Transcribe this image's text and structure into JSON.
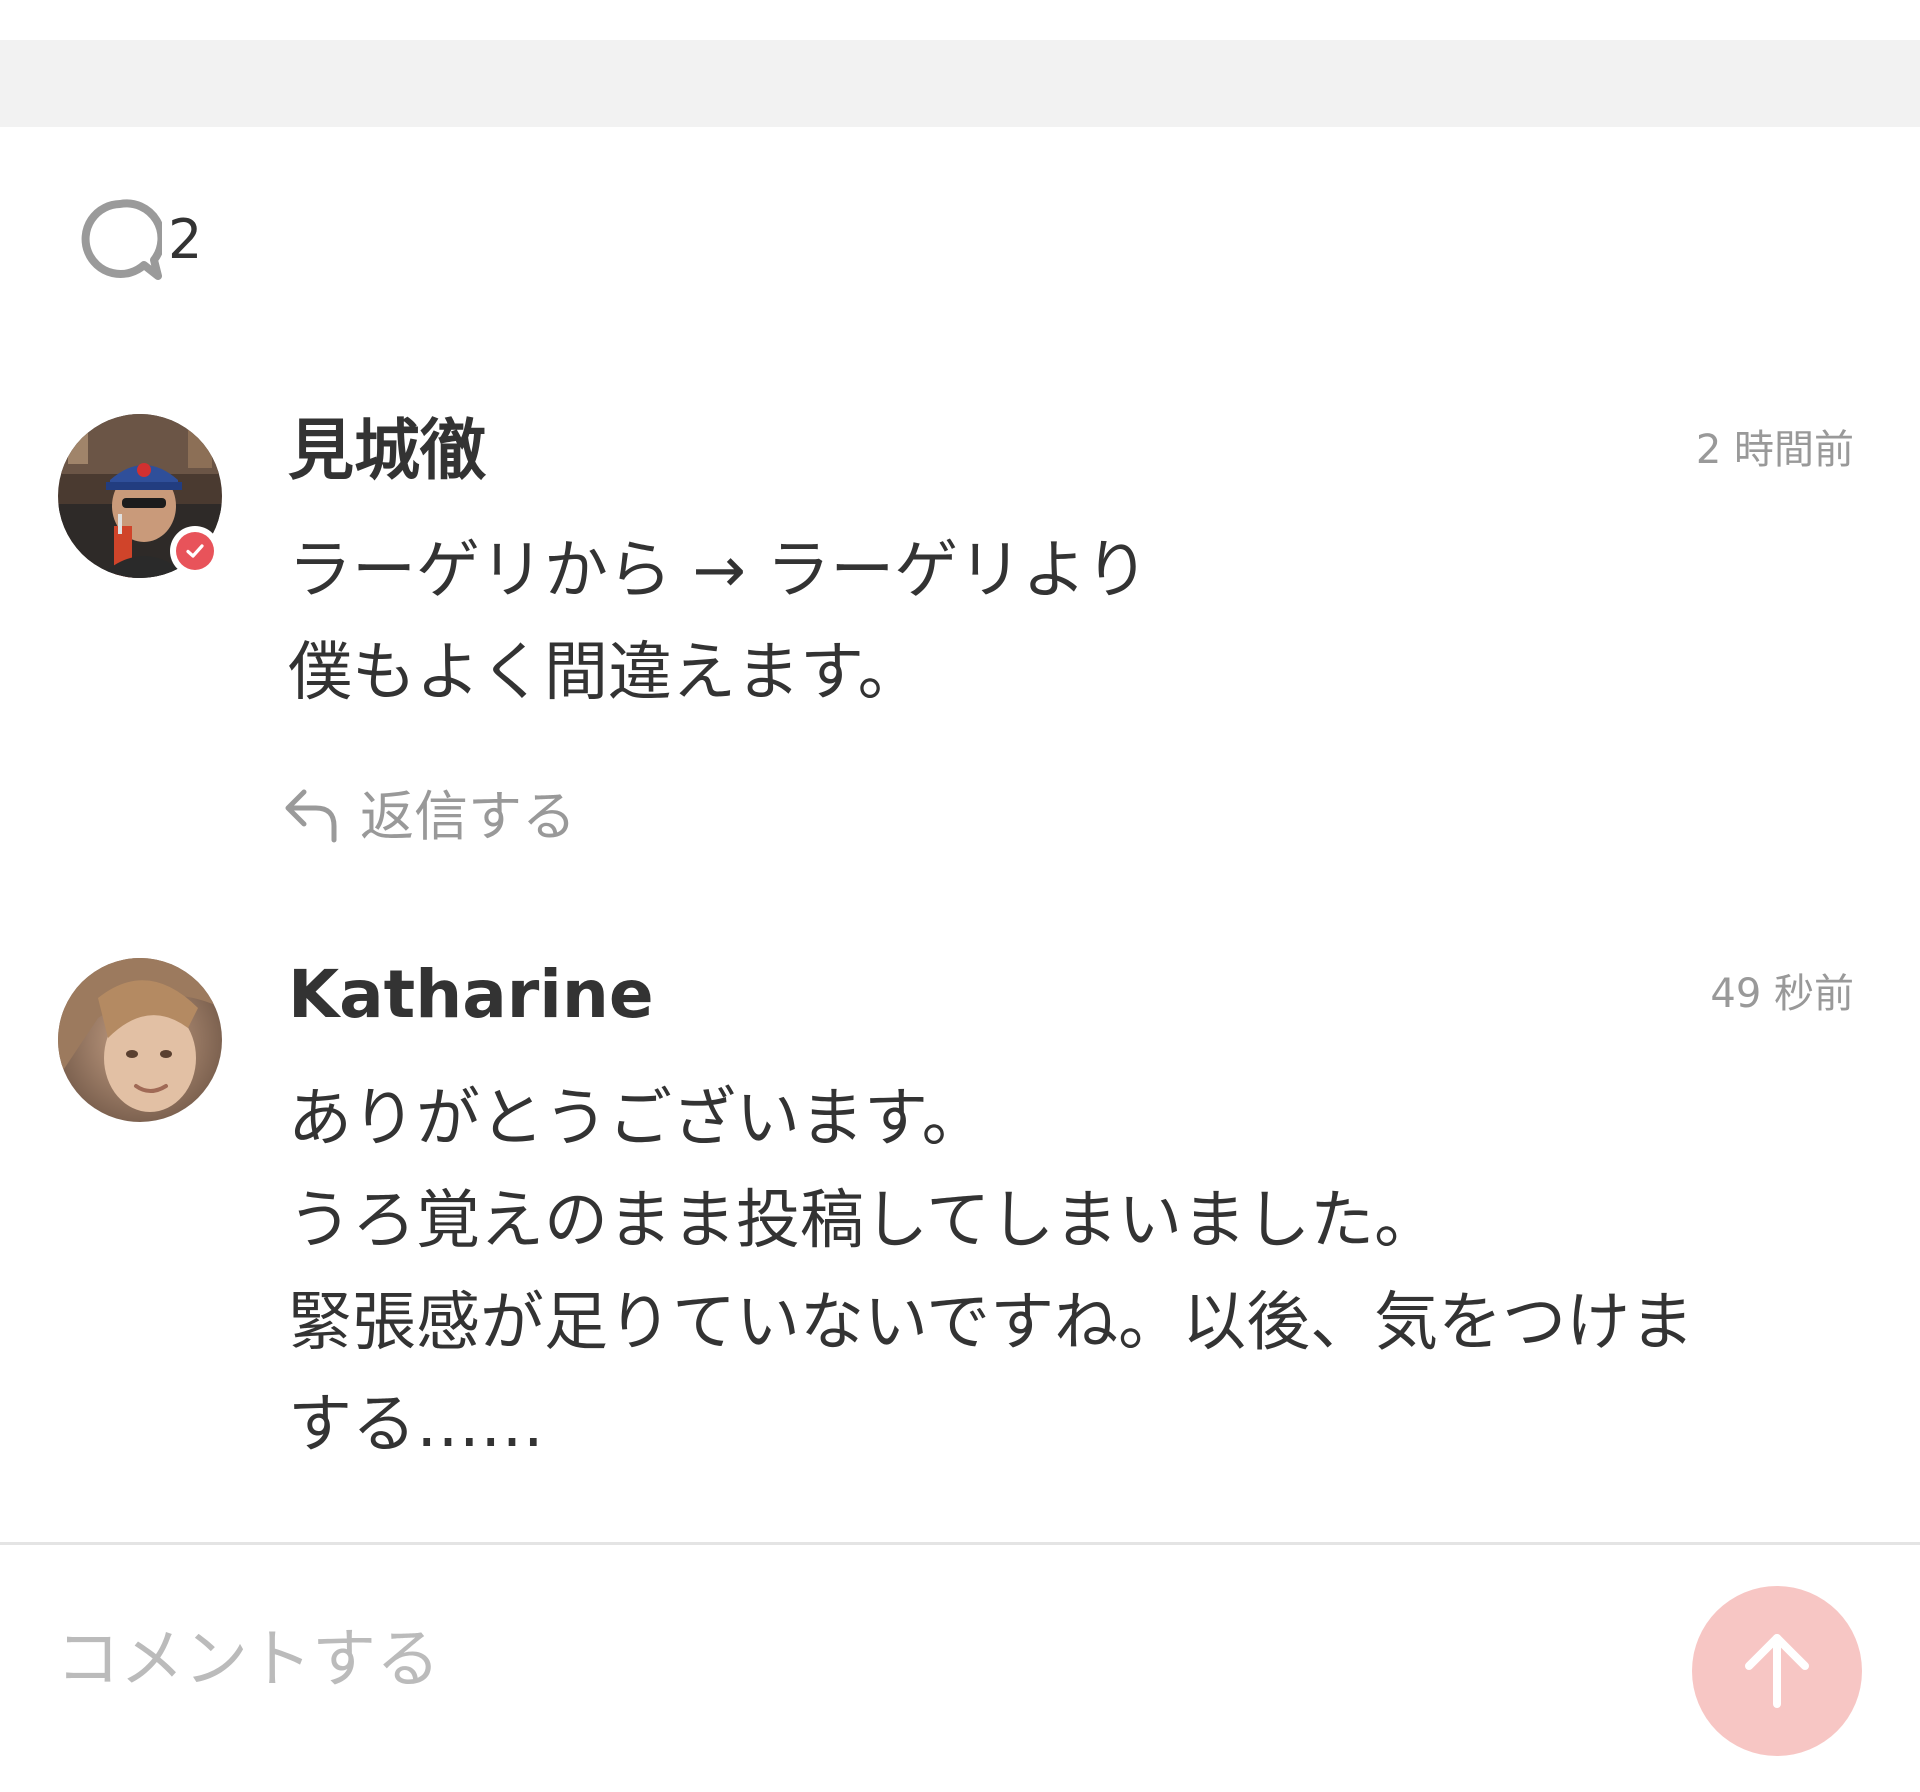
{
  "header": {
    "comment_count": "2"
  },
  "comments": [
    {
      "author": "見城徹",
      "time": "2 時間前",
      "verified": true,
      "avatar": "avatar-man-cap",
      "lines": [
        "ラーゲリから → ラーゲリより",
        "僕もよく間違えます。"
      ],
      "reply_label": "返信する"
    },
    {
      "author": "Katharine",
      "time": "49 秒前",
      "verified": false,
      "avatar": "avatar-woman",
      "lines": [
        "ありがとうございます。",
        "うろ覚えのまま投稿してしまいました。",
        "緊張感が足りていないですね。以後、気をつけま",
        "する……"
      ]
    }
  ],
  "composer": {
    "placeholder": "コメントする",
    "send_icon": "arrow-up-icon"
  },
  "colors": {
    "accent": "#e8535a",
    "send_button": "#f7c6c4",
    "muted_text": "#999999",
    "top_band": "#f2f2f2"
  }
}
